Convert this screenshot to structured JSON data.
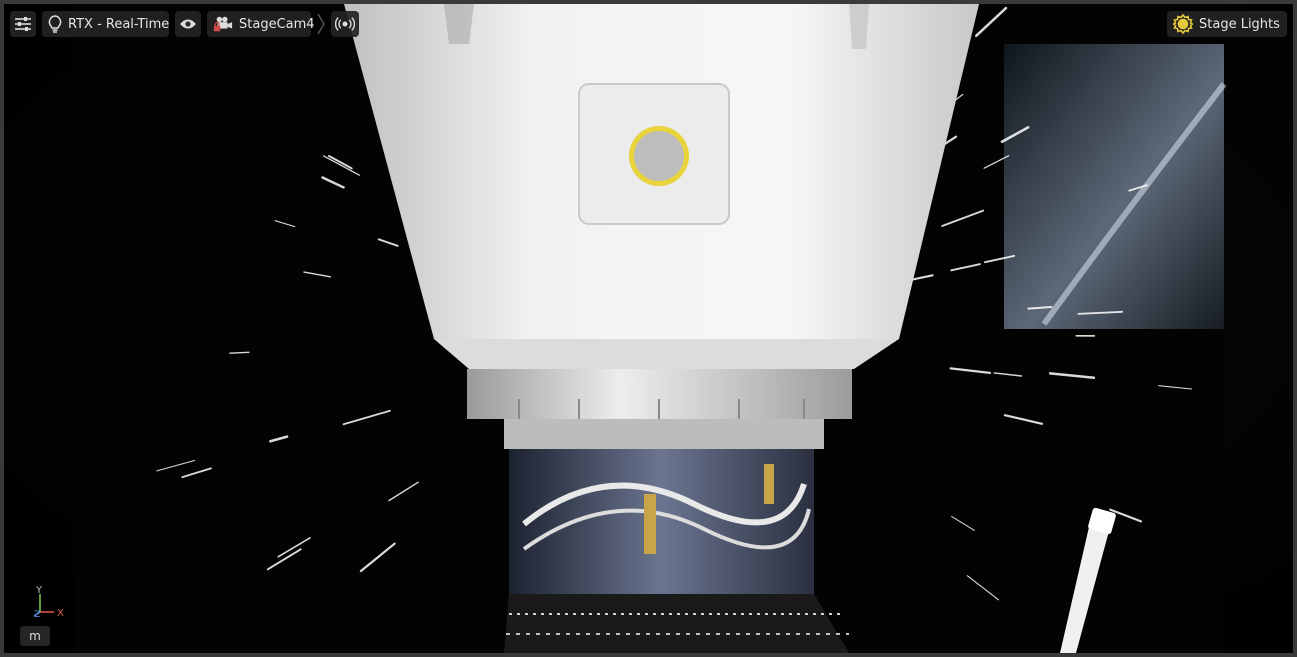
{
  "toolbar": {
    "settings_icon": "sliders-icon",
    "renderer": {
      "icon": "lightbulb-icon",
      "label": "RTX - Real-Time"
    },
    "visibility_icon": "eye-icon",
    "camera": {
      "icon": "camera-lock-icon",
      "label": "StageCam4"
    },
    "broadcast_icon": "broadcast-icon"
  },
  "lights": {
    "icon": "sun-icon",
    "label": "Stage Lights",
    "accent": "#e6c93a"
  },
  "axis": {
    "y": "Y",
    "z": "Z",
    "x": "X",
    "x_color": "#e05a4a",
    "y_color": "#7fcf5a",
    "z_color": "#5a8fe0"
  },
  "unit": {
    "label": "m"
  }
}
